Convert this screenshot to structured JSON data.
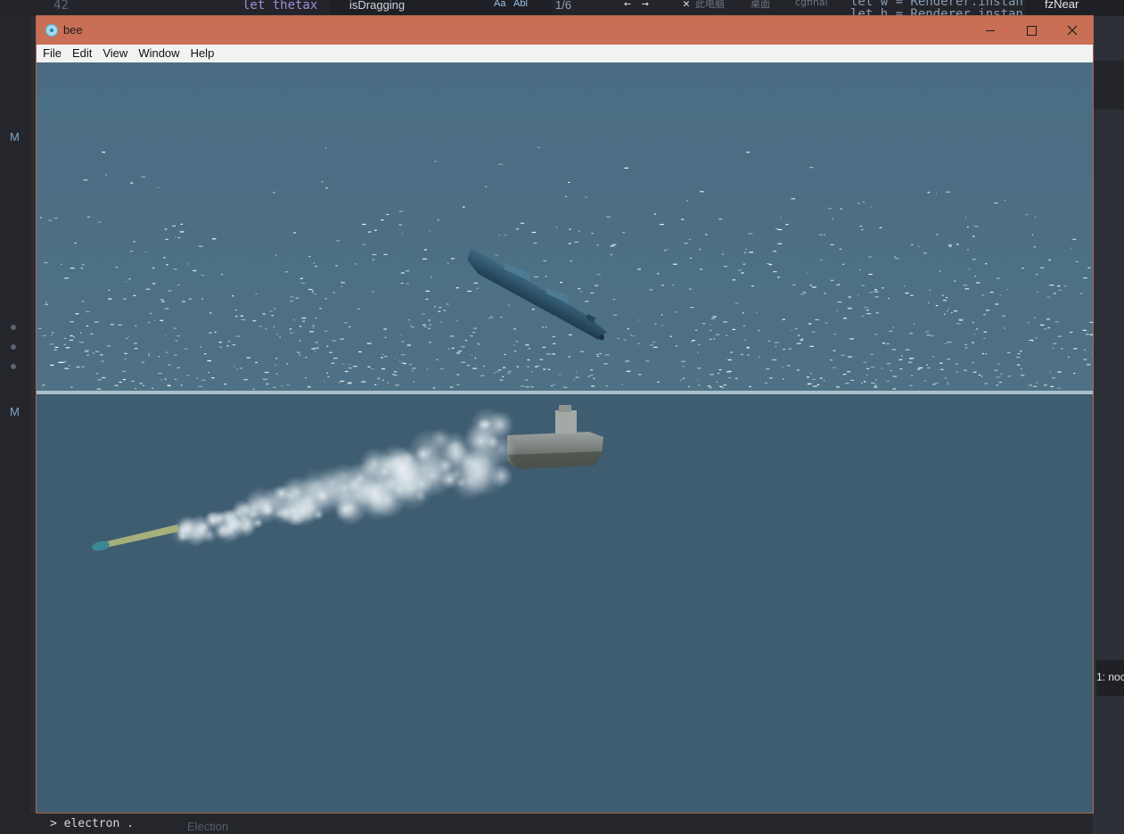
{
  "window": {
    "title": "bee",
    "menu": [
      "File",
      "Edit",
      "View",
      "Window",
      "Help"
    ],
    "icons": {
      "app": "electron-icon",
      "minimize": "minimize-icon",
      "maximize": "maximize-icon",
      "close": "close-icon"
    }
  },
  "background_editor": {
    "line_number": "42",
    "code_top": "let thetax",
    "find_query": "isDragging",
    "find_count": "1/6",
    "find_opt_case": "Aa",
    "find_opt_word": "Abl",
    "breadcrumb": [
      "此电脑",
      "桌面",
      "cgfinal"
    ],
    "code_right_top": "let w = Renderer.instan",
    "code_right_second": "let h = Renderer.instan",
    "right_label": "fzNear",
    "right_panel_label": "1: noc",
    "terminal_command": "> electron .",
    "terminal_faded": "Election",
    "left_markers": [
      "M",
      "M"
    ]
  },
  "colors": {
    "titlebar": "#c86f55",
    "sky": "#4a6d83",
    "water": "#3f5d71",
    "menubar": "#f2f2f2"
  }
}
